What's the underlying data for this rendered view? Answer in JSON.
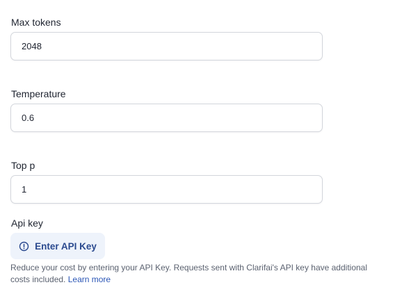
{
  "max_tokens": {
    "label": "Max tokens",
    "value": "2048"
  },
  "temperature": {
    "label": "Temperature",
    "value": "0.6"
  },
  "top_p": {
    "label": "Top p",
    "value": "1"
  },
  "api_key": {
    "label": "Api key",
    "button_label": "Enter API Key",
    "button_icon": "alert-circle-icon",
    "help_text": "Reduce your cost by entering your API Key. Requests sent with Clarifai's API key have additional costs included.",
    "learn_more": "Learn more"
  },
  "colors": {
    "accent": "#2b4a8f",
    "button_bg": "#eef3fb",
    "link": "#2b56b6",
    "border": "#d3d6dc",
    "muted_text": "#5b6270"
  }
}
